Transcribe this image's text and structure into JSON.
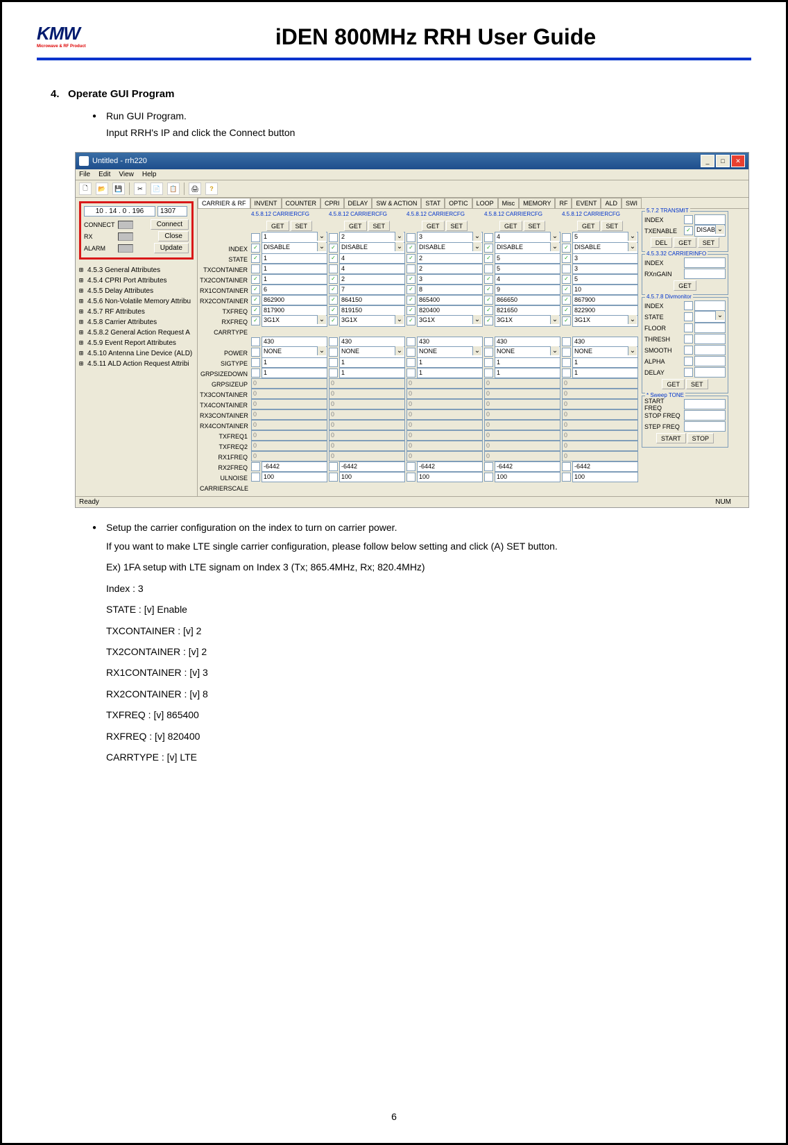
{
  "doc": {
    "logo_main": "KMW",
    "logo_sub": "Microwave & RF Product",
    "title": "iDEN 800MHz RRH User Guide",
    "section_num": "4.",
    "section_title": "Operate GUI Program",
    "bullet1": "Run GUI Program.",
    "subtext1": "Input RRH's IP and click the Connect button",
    "bullet2": "Setup the carrier configuration on the index to turn on carrier power.",
    "post1": "If you want to make LTE single carrier configuration, please follow below setting and click (A) SET button.",
    "post2": "Ex) 1FA setup with LTE signam on Index 3 (Tx; 865.4MHz, Rx; 820.4MHz)",
    "cfg": [
      "Index : 3",
      "STATE : [v] Enable",
      "TXCONTAINER : [v] 2",
      "TX2CONTAINER : [v] 2",
      "RX1CONTAINER : [v] 3",
      "RX2CONTAINER : [v] 8",
      "TXFREQ : [v] 865400",
      "RXFREQ : [v] 820400",
      "CARRTYPE : [v] LTE"
    ],
    "page_num": "6"
  },
  "app": {
    "title": "Untitled - rrh220",
    "menu": [
      "File",
      "Edit",
      "View",
      "Help"
    ],
    "ip": "10  .  14  .   0   . 196",
    "port": "1307",
    "conn_labels": [
      "CONNECT",
      "RX",
      "ALARM"
    ],
    "btns": [
      "Connect",
      "Close",
      "Update"
    ],
    "tree": [
      "4.5.3 General Attributes",
      "4.5.4 CPRI Port Attributes",
      "4.5.5 Delay Attributes",
      "4.5.6 Non-Volatile Memory Attribu",
      "4.5.7 RF Attributes",
      "4.5.8 Carrier Attributes",
      "4.5.8.2 General Action Request A",
      "4.5.9 Event Report Attributes",
      "4.5.10 Antenna Line Device (ALD)",
      "4.5.11 ALD Action Request Attribi"
    ],
    "tabs": [
      "CARRIER & RF",
      "INVENT",
      "COUNTER",
      "CPRI",
      "DELAY",
      "SW & ACTION",
      "STAT",
      "OPTIC",
      "LOOP",
      "Misc",
      "MEMORY",
      "RF",
      "EVENT",
      "ALD",
      "SWI"
    ],
    "row_labels": [
      "INDEX",
      "STATE",
      "TXCONTAINER",
      "TX2CONTAINER",
      "RX1CONTAINER",
      "RX2CONTAINER",
      "TXFREQ",
      "RXFREQ",
      "CARRTYPE",
      "",
      "POWER",
      "SIGTYPE",
      "GRPSIZEDOWN",
      "GRPSIZEUP",
      "TX3CONTAINER",
      "TX4CONTAINER",
      "RX3CONTAINER",
      "RX4CONTAINER",
      "TXFREQ1",
      "TXFREQ2",
      "RX1FREQ",
      "RX2FREQ",
      "ULNOISE",
      "CARRIERSCALE"
    ],
    "col_header": "4.5.8.12 CARRIERCFG",
    "get": "GET",
    "set": "SET",
    "del": "DEL",
    "start": "START",
    "stop": "STOP",
    "cols": [
      {
        "idx": "1",
        "state": "DISABLE",
        "txc": "1",
        "tx2c": "1",
        "rx1c": "1",
        "rx2c": "6",
        "txf": "862900",
        "rxf": "817900",
        "ct": "3G1X",
        "pwr": "430",
        "sig": "NONE",
        "gd": "1",
        "gu": "1",
        "uln": "-6442",
        "cs": "100"
      },
      {
        "idx": "2",
        "state": "DISABLE",
        "txc": "4",
        "tx2c": "4",
        "rx1c": "2",
        "rx2c": "7",
        "txf": "864150",
        "rxf": "819150",
        "ct": "3G1X",
        "pwr": "430",
        "sig": "NONE",
        "gd": "1",
        "gu": "1",
        "uln": "-6442",
        "cs": "100"
      },
      {
        "idx": "3",
        "state": "DISABLE",
        "txc": "2",
        "tx2c": "2",
        "rx1c": "3",
        "rx2c": "8",
        "txf": "865400",
        "rxf": "820400",
        "ct": "3G1X",
        "pwr": "430",
        "sig": "NONE",
        "gd": "1",
        "gu": "1",
        "uln": "-6442",
        "cs": "100"
      },
      {
        "idx": "4",
        "state": "DISABLE",
        "txc": "5",
        "tx2c": "5",
        "rx1c": "4",
        "rx2c": "9",
        "txf": "866650",
        "rxf": "821650",
        "ct": "3G1X",
        "pwr": "430",
        "sig": "NONE",
        "gd": "1",
        "gu": "1",
        "uln": "-6442",
        "cs": "100"
      },
      {
        "idx": "5",
        "state": "DISABLE",
        "txc": "3",
        "tx2c": "3",
        "rx1c": "5",
        "rx2c": "10",
        "txf": "867900",
        "rxf": "822900",
        "ct": "3G1X",
        "pwr": "430",
        "sig": "NONE",
        "gd": "1",
        "gu": "1",
        "uln": "-6442",
        "cs": "100"
      }
    ],
    "transmit": {
      "title": "5.7.2 TRANSMIT",
      "r1": "INDEX",
      "r2": "TXENABLE",
      "v2": "DISABLE"
    },
    "carrierinfo": {
      "title": "4.5.3.32 CARRIERINFO",
      "r1": "INDEX",
      "r2": "RXnGAIN"
    },
    "divmon": {
      "title": "4.5.7.8 Divmonitor",
      "rows": [
        "INDEX",
        "STATE",
        "FLOOR",
        "THRESH",
        "SMOOTH",
        "ALPHA",
        "DELAY"
      ]
    },
    "sweep": {
      "title": "* Sweep TONE",
      "rows": [
        "START FREQ",
        "STOP FREQ",
        "STEP FREQ"
      ]
    },
    "status": "Ready",
    "status_r": "NUM"
  }
}
